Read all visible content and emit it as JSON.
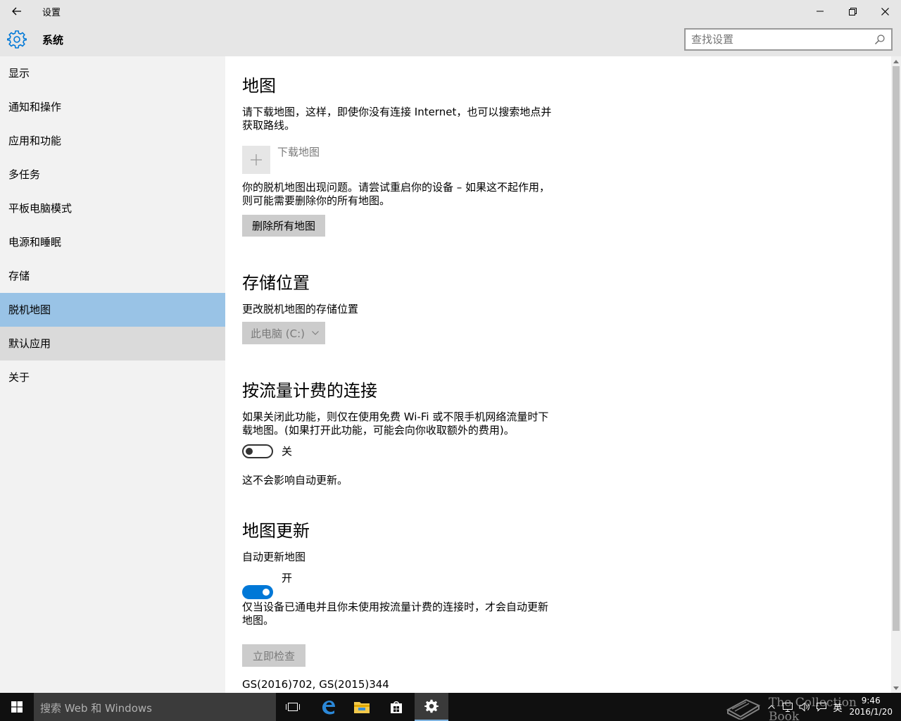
{
  "window": {
    "title": "设置",
    "header_title": "系统"
  },
  "search": {
    "placeholder": "查找设置"
  },
  "sidebar": {
    "items": [
      {
        "label": "显示"
      },
      {
        "label": "通知和操作"
      },
      {
        "label": "应用和功能"
      },
      {
        "label": "多任务"
      },
      {
        "label": "平板电脑模式"
      },
      {
        "label": "电源和睡眠"
      },
      {
        "label": "存储"
      },
      {
        "label": "脱机地图"
      },
      {
        "label": "默认应用"
      },
      {
        "label": "关于"
      }
    ]
  },
  "content": {
    "maps": {
      "heading": "地图",
      "desc_line1": "请下载地图，这样，即使你没有连接 Internet，也可以搜索地点并",
      "desc_line2": "获取路线。",
      "download_label": "下载地图",
      "problem_line1": "你的脱机地图出现问题。请尝试重启你的设备 – 如果这不起作用，",
      "problem_line2": "则可能需要删除你的所有地图。",
      "delete_button": "删除所有地图"
    },
    "storage": {
      "heading": "存储位置",
      "label": "更改脱机地图的存储位置",
      "selected": "此电脑 (C:)"
    },
    "metered": {
      "heading": "按流量计费的连接",
      "desc_line1": "如果关闭此功能，则仅在使用免费 Wi-Fi 或不限手机网络流量时下",
      "desc_line2": "载地图。(如果打开此功能，可能会向你收取额外的费用)。",
      "toggle_state": "关",
      "note": "这不会影响自动更新。"
    },
    "updates": {
      "heading": "地图更新",
      "label": "自动更新地图",
      "toggle_state": "开",
      "desc_line1": "仅当设备已通电并且你未使用按流量计费的连接时，才会自动更新",
      "desc_line2": "地图。",
      "check_button": "立即检查",
      "copyright": "GS(2016)702, GS(2015)344"
    }
  },
  "taskbar": {
    "search_text": "搜索 Web 和 Windows",
    "ime": "英",
    "time": "9:46",
    "date": "2016/1/20",
    "watermark": "The Collection Book"
  },
  "colors": {
    "accent": "#0078d7",
    "nav_active": "#99c3e6",
    "sidebar_bg": "#f2f2f2"
  }
}
